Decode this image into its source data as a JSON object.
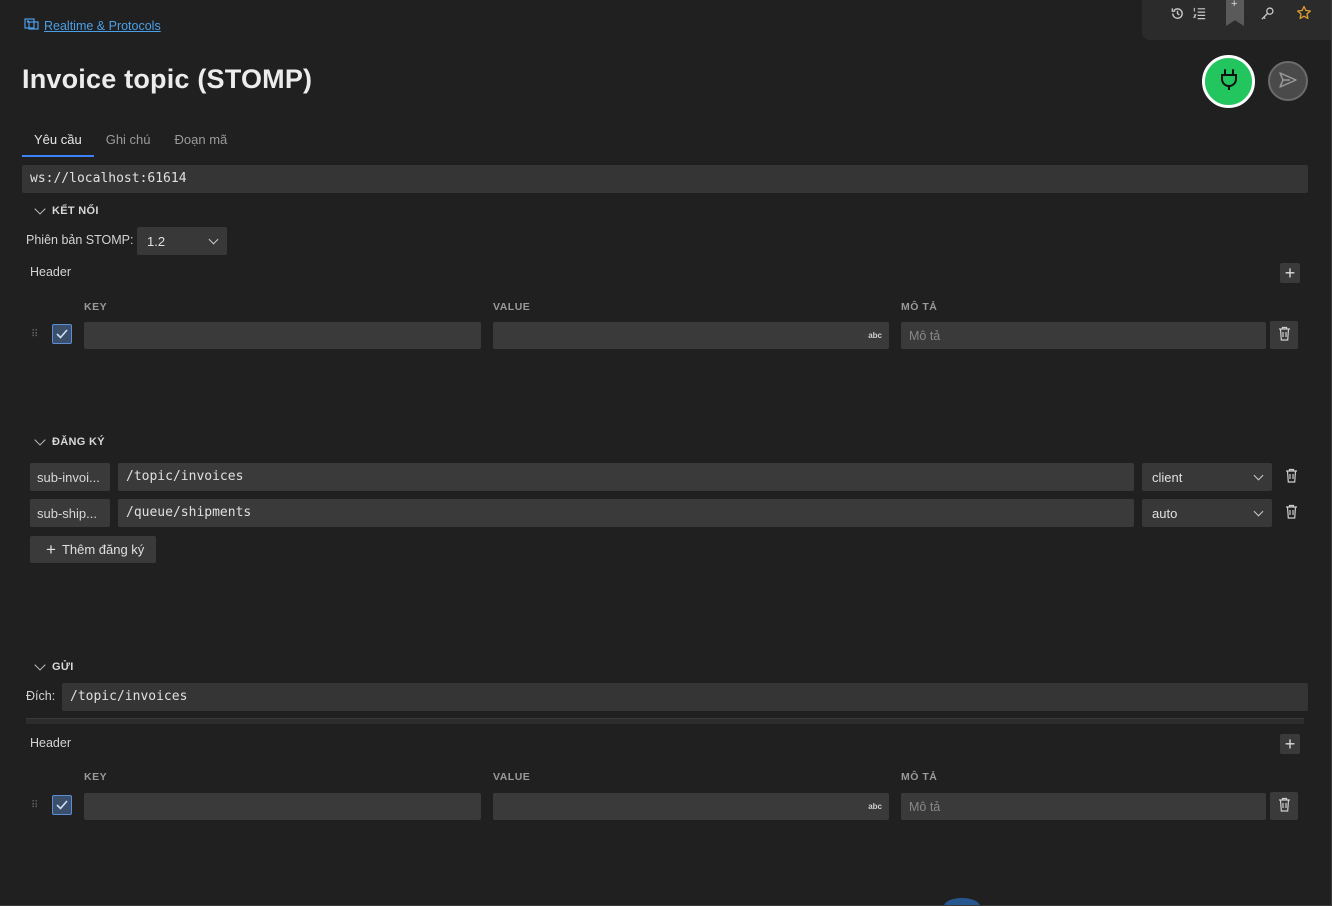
{
  "breadcrumb": {
    "label": "Realtime & Protocols"
  },
  "page": {
    "title": "Invoice topic (STOMP)"
  },
  "tabs": [
    {
      "label": "Yêu cầu",
      "active": true
    },
    {
      "label": "Ghi chú",
      "active": false
    },
    {
      "label": "Đoạn mã",
      "active": false
    }
  ],
  "request": {
    "url": "ws://localhost:61614"
  },
  "connection": {
    "section_title": "KẾT NỐI",
    "stomp_version_label": "Phiên bản STOMP:",
    "stomp_version": "1.2",
    "header_label": "Header",
    "columns": {
      "key": "KEY",
      "value": "VALUE",
      "description": "MÔ TẢ"
    },
    "row": {
      "key": "",
      "value": "",
      "value_badge": "abc",
      "description_placeholder": "Mô tả",
      "checked": true
    }
  },
  "subscriptions": {
    "section_title": "ĐĂNG KÝ",
    "items": [
      {
        "id": "sub-invoi...",
        "destination": "/topic/invoices",
        "ack": "client"
      },
      {
        "id": "sub-ship...",
        "destination": "/queue/shipments",
        "ack": "auto"
      }
    ],
    "add_label": "Thêm đăng ký"
  },
  "send": {
    "section_title": "GỬI",
    "destination_label": "Đích:",
    "destination": "/topic/invoices",
    "header_label": "Header",
    "columns": {
      "key": "KEY",
      "value": "VALUE",
      "description": "MÔ TẢ"
    },
    "row": {
      "key": "",
      "value": "",
      "value_badge": "abc",
      "description_placeholder": "Mô tả",
      "checked": true
    }
  },
  "colors": {
    "connect": "#22c55e",
    "accent": "#3b82f6",
    "link": "#4a9fe8",
    "star": "#e0a030"
  },
  "icons": [
    "history-icon",
    "list-icon",
    "bookmark-icon",
    "key-icon",
    "star-icon",
    "plug-icon",
    "send-icon",
    "trash-icon",
    "plus-icon",
    "chevron-down-icon",
    "drag-handle-icon",
    "checkbox-icon"
  ]
}
